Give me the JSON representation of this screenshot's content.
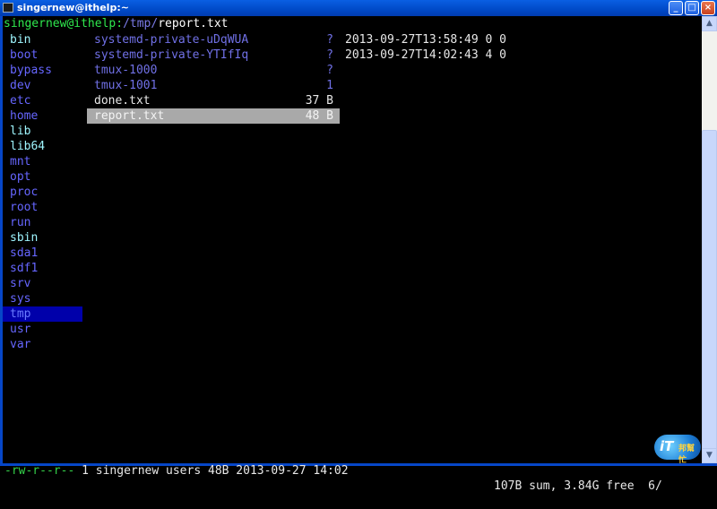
{
  "window": {
    "title": "singernew@ithelp:~",
    "min": "_",
    "max": "□",
    "close": "×"
  },
  "prompt": {
    "user": "singernew@ithelp:",
    "path": "/tmp/",
    "file": "report.txt"
  },
  "dirs": [
    {
      "name": "bin",
      "bold": true
    },
    {
      "name": "boot"
    },
    {
      "name": "bypass"
    },
    {
      "name": "dev"
    },
    {
      "name": "etc"
    },
    {
      "name": "home"
    },
    {
      "name": "lib",
      "bold": true
    },
    {
      "name": "lib64",
      "bold": true
    },
    {
      "name": "mnt"
    },
    {
      "name": "opt"
    },
    {
      "name": "proc"
    },
    {
      "name": "root"
    },
    {
      "name": "run"
    },
    {
      "name": "sbin",
      "bold": true
    },
    {
      "name": "sda1"
    },
    {
      "name": "sdf1"
    },
    {
      "name": "srv"
    },
    {
      "name": "sys"
    },
    {
      "name": "tmp",
      "selected": true
    },
    {
      "name": "usr"
    },
    {
      "name": "var"
    }
  ],
  "entries": [
    {
      "name": "systemd-private-uDqWUA",
      "size": "?",
      "type": "dir"
    },
    {
      "name": "systemd-private-YTIfIq",
      "size": "?",
      "type": "dir"
    },
    {
      "name": "tmux-1000",
      "size": "?",
      "type": "dir"
    },
    {
      "name": "tmux-1001",
      "size": "1",
      "type": "dir"
    },
    {
      "name": "done.txt",
      "size": "37 B",
      "type": "file"
    },
    {
      "name": "report.txt",
      "size": "48 B",
      "type": "file",
      "current": true
    }
  ],
  "preview": [
    "2013-09-27T13:58:49 0 0",
    "2013-09-27T14:02:43 4 0"
  ],
  "status": {
    "perms": "-rw-r--r--",
    "info": " 1 singernew users 48B 2013-09-27 14:02",
    "summary": "107B sum, 3.84G free  6/"
  },
  "logo": {
    "main": "iT",
    "sub": "邦幫忙"
  },
  "scrollbar": {
    "up": "▲",
    "down": "▼"
  }
}
